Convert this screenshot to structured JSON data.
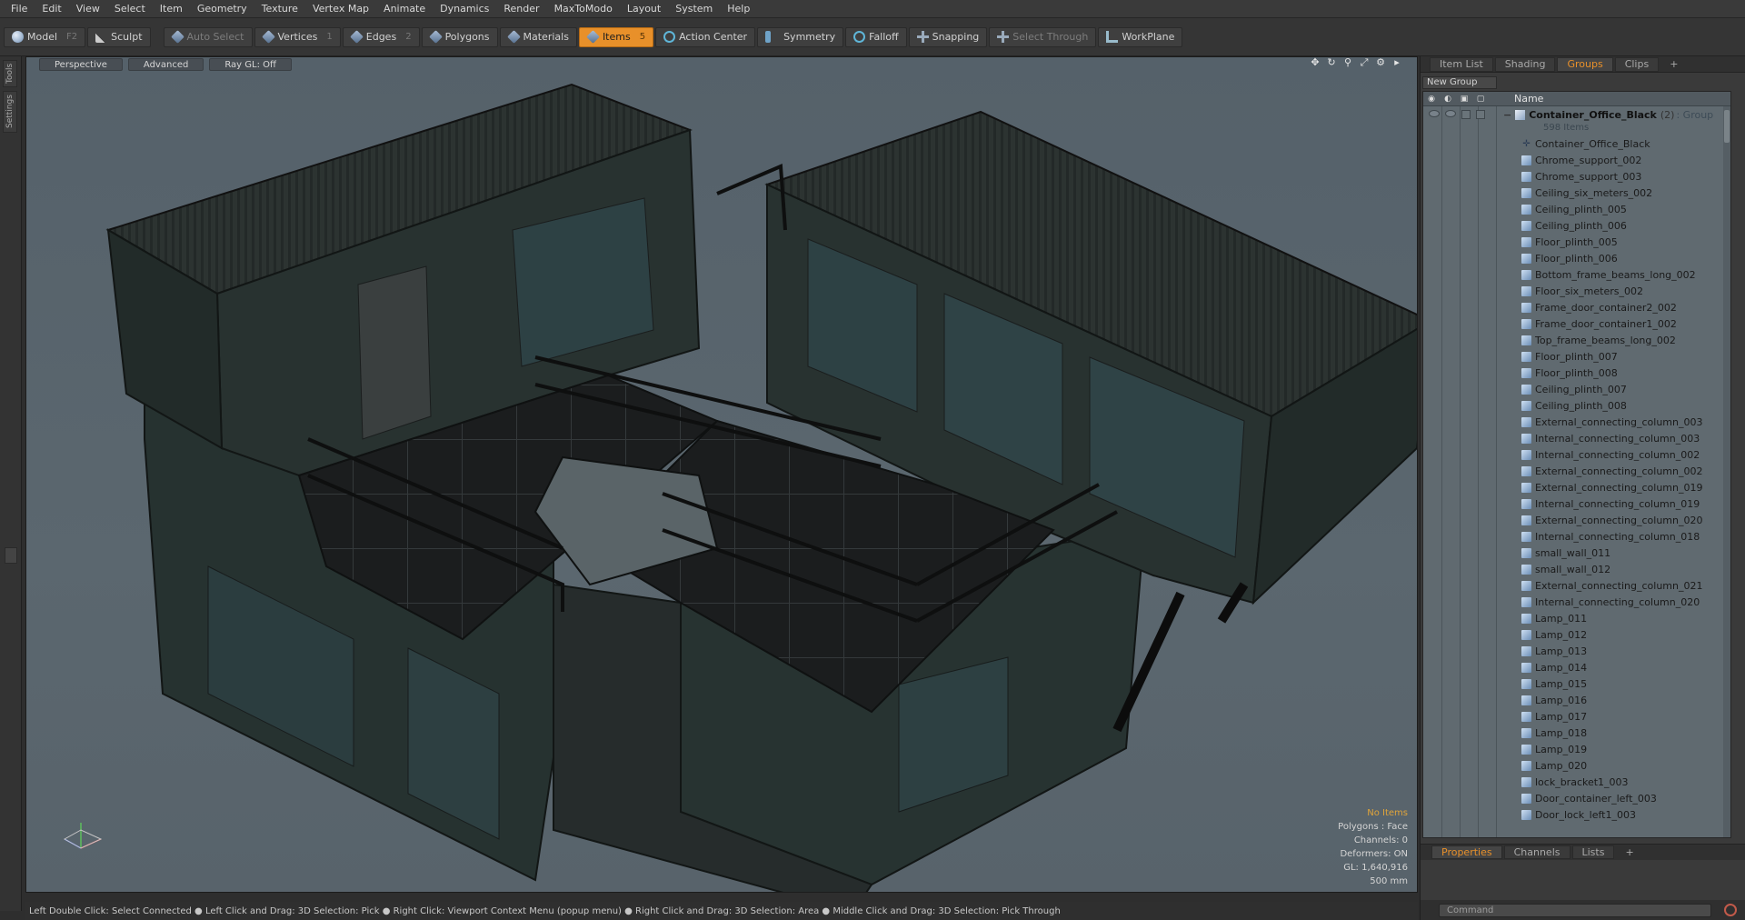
{
  "menu": [
    "File",
    "Edit",
    "View",
    "Select",
    "Item",
    "Geometry",
    "Texture",
    "Vertex Map",
    "Animate",
    "Dynamics",
    "Render",
    "MaxToModo",
    "Layout",
    "System",
    "Help"
  ],
  "toolbar": {
    "model": {
      "label": "Model",
      "key": "F2"
    },
    "sculpt": {
      "label": "Sculpt"
    },
    "auto_select": {
      "label": "Auto Select"
    },
    "vertices": {
      "label": "Vertices",
      "key": "1"
    },
    "edges": {
      "label": "Edges",
      "key": "2"
    },
    "polygons": {
      "label": "Polygons"
    },
    "materials": {
      "label": "Materials"
    },
    "items": {
      "label": "Items",
      "key": "5"
    },
    "action_center": {
      "label": "Action Center"
    },
    "symmetry": {
      "label": "Symmetry"
    },
    "falloff": {
      "label": "Falloff"
    },
    "snapping": {
      "label": "Snapping"
    },
    "select_through": {
      "label": "Select Through"
    },
    "workplane": {
      "label": "WorkPlane"
    }
  },
  "left_tabs": [
    "Tools",
    "Settings"
  ],
  "viewport": {
    "view": "Perspective",
    "mode": "Advanced",
    "raygl": "Ray GL: Off",
    "info": {
      "items": "No Items",
      "polygons": "Polygons : Face",
      "channels": "Channels: 0",
      "deformers": "Deformers: ON",
      "gl": "GL: 1,640,916",
      "scale": "500 mm"
    },
    "accent_color": "#e0a43a"
  },
  "status": "Left Double Click: Select Connected ● Left Click and Drag: 3D Selection: Pick ● Right Click: Viewport Context Menu (popup menu) ● Right Click and Drag: 3D Selection: Area ● Middle Click and Drag: 3D Selection: Pick Through",
  "right_panel": {
    "tabs": [
      "Item List",
      "Shading",
      "Groups",
      "Clips",
      "+"
    ],
    "active_tab": "Groups",
    "new_group": "New Group",
    "column_name": "Name",
    "group": {
      "name": "Container_Office_Black",
      "count": "(2)",
      "type": ": Group",
      "items": "598 Items"
    },
    "items": [
      {
        "name": "Container_Office_Black",
        "kind": "locator"
      },
      {
        "name": "Chrome_support_002",
        "kind": "mesh"
      },
      {
        "name": "Chrome_support_003",
        "kind": "mesh"
      },
      {
        "name": "Ceiling_six_meters_002",
        "kind": "mesh"
      },
      {
        "name": "Ceiling_plinth_005",
        "kind": "mesh"
      },
      {
        "name": "Ceiling_plinth_006",
        "kind": "mesh"
      },
      {
        "name": "Floor_plinth_005",
        "kind": "mesh"
      },
      {
        "name": "Floor_plinth_006",
        "kind": "mesh"
      },
      {
        "name": "Bottom_frame_beams_long_002",
        "kind": "mesh"
      },
      {
        "name": "Floor_six_meters_002",
        "kind": "mesh"
      },
      {
        "name": "Frame_door_container2_002",
        "kind": "mesh"
      },
      {
        "name": "Frame_door_container1_002",
        "kind": "mesh"
      },
      {
        "name": "Top_frame_beams_long_002",
        "kind": "mesh"
      },
      {
        "name": "Floor_plinth_007",
        "kind": "mesh"
      },
      {
        "name": "Floor_plinth_008",
        "kind": "mesh"
      },
      {
        "name": "Ceiling_plinth_007",
        "kind": "mesh"
      },
      {
        "name": "Ceiling_plinth_008",
        "kind": "mesh"
      },
      {
        "name": "External_connecting_column_003",
        "kind": "mesh"
      },
      {
        "name": "Internal_connecting_column_003",
        "kind": "mesh"
      },
      {
        "name": "Internal_connecting_column_002",
        "kind": "mesh"
      },
      {
        "name": "External_connecting_column_002",
        "kind": "mesh"
      },
      {
        "name": "External_connecting_column_019",
        "kind": "mesh"
      },
      {
        "name": "Internal_connecting_column_019",
        "kind": "mesh"
      },
      {
        "name": "External_connecting_column_020",
        "kind": "mesh"
      },
      {
        "name": "Internal_connecting_column_018",
        "kind": "mesh"
      },
      {
        "name": "small_wall_011",
        "kind": "mesh"
      },
      {
        "name": "small_wall_012",
        "kind": "mesh"
      },
      {
        "name": "External_connecting_column_021",
        "kind": "mesh"
      },
      {
        "name": "Internal_connecting_column_020",
        "kind": "mesh"
      },
      {
        "name": "Lamp_011",
        "kind": "mesh"
      },
      {
        "name": "Lamp_012",
        "kind": "mesh"
      },
      {
        "name": "Lamp_013",
        "kind": "mesh"
      },
      {
        "name": "Lamp_014",
        "kind": "mesh"
      },
      {
        "name": "Lamp_015",
        "kind": "mesh"
      },
      {
        "name": "Lamp_016",
        "kind": "mesh"
      },
      {
        "name": "Lamp_017",
        "kind": "mesh"
      },
      {
        "name": "Lamp_018",
        "kind": "mesh"
      },
      {
        "name": "Lamp_019",
        "kind": "mesh"
      },
      {
        "name": "Lamp_020",
        "kind": "mesh"
      },
      {
        "name": "lock_bracket1_003",
        "kind": "mesh"
      },
      {
        "name": "Door_container_left_003",
        "kind": "mesh"
      },
      {
        "name": "Door_lock_left1_003",
        "kind": "mesh"
      }
    ],
    "bottom_tabs": [
      "Properties",
      "Channels",
      "Lists",
      "+"
    ],
    "bottom_active": "Properties",
    "command_placeholder": "Command"
  }
}
